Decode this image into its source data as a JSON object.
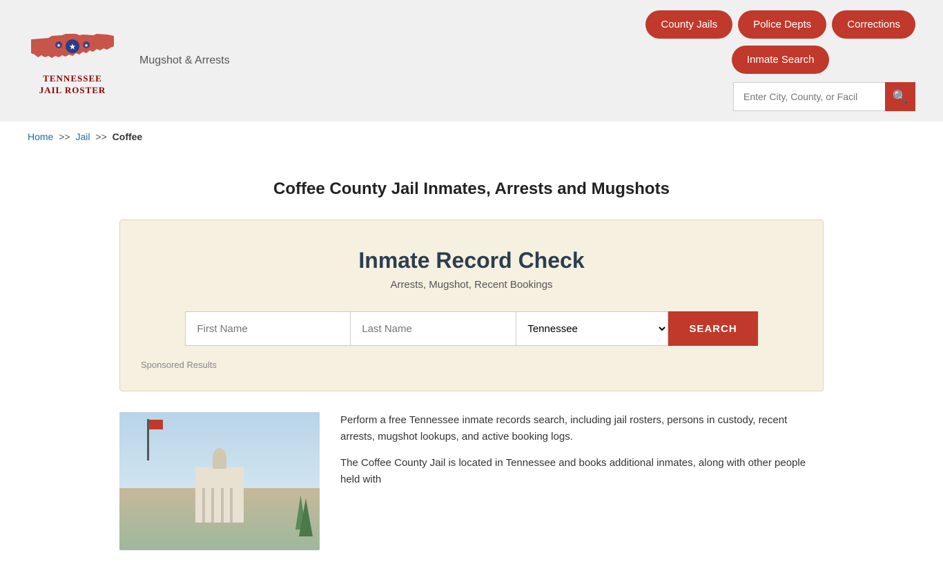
{
  "header": {
    "logo_title_line1": "TENNESSEE",
    "logo_title_line2": "JAIL ROSTER",
    "mugshot_text": "Mugshot & Arrests",
    "search_placeholder": "Enter City, County, or Facil"
  },
  "nav": {
    "btn1": "County Jails",
    "btn2": "Police Depts",
    "btn3": "Corrections",
    "btn4": "Inmate Search"
  },
  "breadcrumb": {
    "home": "Home",
    "sep1": ">>",
    "jail": "Jail",
    "sep2": ">>",
    "current": "Coffee"
  },
  "page": {
    "title": "Coffee County Jail Inmates, Arrests and Mugshots"
  },
  "record_check": {
    "title": "Inmate Record Check",
    "subtitle": "Arrests, Mugshot, Recent Bookings",
    "first_name_placeholder": "First Name",
    "last_name_placeholder": "Last Name",
    "state_value": "Tennessee",
    "search_btn": "SEARCH",
    "sponsored_label": "Sponsored Results"
  },
  "bottom": {
    "paragraph1": "Perform a free Tennessee inmate records search, including jail rosters, persons in custody, recent arrests, mugshot lookups, and active booking logs.",
    "paragraph2": "The Coffee County Jail is located in Tennessee and books additional inmates, along with other people held with"
  }
}
